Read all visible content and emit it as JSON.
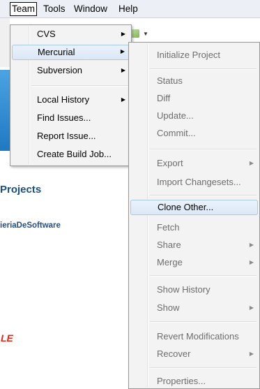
{
  "menubar": {
    "items": [
      "Team",
      "Tools",
      "Window",
      "Help"
    ]
  },
  "background": {
    "projects_title": "Projects",
    "project_link": "ieriaDeSoftware",
    "logo_text": "LE"
  },
  "team_menu": {
    "items": [
      {
        "label": "CVS",
        "submenu": true
      },
      {
        "label": "Mercurial",
        "submenu": true,
        "selected": true
      },
      {
        "label": "Subversion",
        "submenu": true
      },
      {
        "label": "Local History",
        "submenu": true
      },
      {
        "label": "Find Issues...",
        "submenu": false
      },
      {
        "label": "Report Issue...",
        "submenu": false
      },
      {
        "label": "Create Build Job...",
        "submenu": false
      }
    ]
  },
  "mercurial_menu": {
    "items": [
      {
        "label": "Initialize Project",
        "submenu": false
      },
      {
        "label": "Status",
        "submenu": false
      },
      {
        "label": "Diff",
        "submenu": false
      },
      {
        "label": "Update...",
        "submenu": false
      },
      {
        "label": "Commit...",
        "submenu": false
      },
      {
        "label": "Export",
        "submenu": true
      },
      {
        "label": "Import Changesets...",
        "submenu": false
      },
      {
        "label": "Clone Other...",
        "submenu": false,
        "selected": true
      },
      {
        "label": "Fetch",
        "submenu": false
      },
      {
        "label": "Share",
        "submenu": true
      },
      {
        "label": "Merge",
        "submenu": true
      },
      {
        "label": "Show History",
        "submenu": false
      },
      {
        "label": "Show",
        "submenu": true
      },
      {
        "label": "Revert Modifications",
        "submenu": false
      },
      {
        "label": "Recover",
        "submenu": true
      },
      {
        "label": "Properties...",
        "submenu": false
      }
    ]
  },
  "colors": {
    "menubar_bg": "#ecf0f6",
    "menu_bg": "#f3f3f3",
    "selection_border": "#a8c8ea",
    "disabled_text": "#6d6d6d",
    "logo": "#e1261c"
  }
}
